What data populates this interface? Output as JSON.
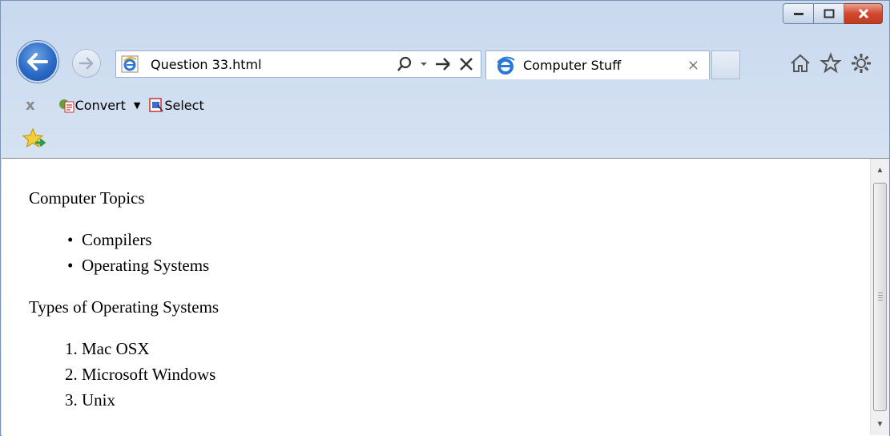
{
  "browser": {
    "address_text": "Question 33.html",
    "tab_title": "Computer Stuff",
    "tab_close_glyph": "×",
    "icons": [
      "back-icon",
      "forward-icon",
      "ie-icon",
      "search-icon",
      "dropdown-icon",
      "go-icon",
      "stop-icon",
      "home-icon",
      "favorites-star-icon",
      "gear-icon",
      "minimize-icon",
      "maximize-icon",
      "close-icon"
    ]
  },
  "command_bar": {
    "close_glyph": "x",
    "convert_label": "Convert",
    "select_label": "Select"
  },
  "page": {
    "heading1": "Computer Topics",
    "topics": [
      "Compilers",
      "Operating Systems"
    ],
    "heading2": "Types of Operating Systems",
    "os_types": [
      "Mac OSX",
      "Microsoft Windows",
      "Unix"
    ]
  },
  "colors": {
    "accent": "#2a6ac6",
    "close_red": "#d2482f",
    "chrome_bg": "#d6e3f3"
  }
}
